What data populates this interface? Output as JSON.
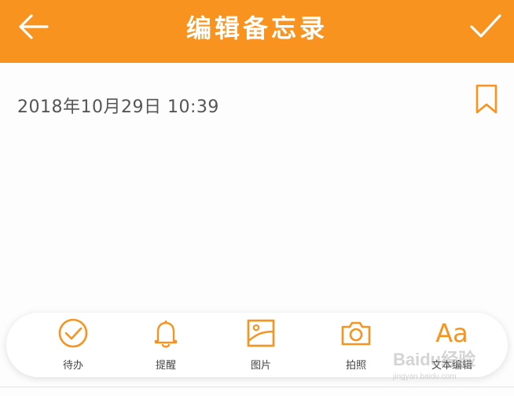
{
  "header": {
    "title": "编辑备忘录",
    "back_icon": "arrow-left-icon",
    "confirm_icon": "check-icon"
  },
  "note": {
    "datetime": "2018年10月29日  10:39",
    "bookmark_icon": "bookmark-icon"
  },
  "toolbar": {
    "items": [
      {
        "label": "待办",
        "icon": "check-circle-icon"
      },
      {
        "label": "提醒",
        "icon": "bell-icon"
      },
      {
        "label": "图片",
        "icon": "image-icon"
      },
      {
        "label": "拍照",
        "icon": "camera-icon"
      },
      {
        "label": "文本编辑",
        "icon": "text-format-icon",
        "glyph": "Aa"
      }
    ]
  },
  "watermark": {
    "brand": "Baidu经验",
    "url": "jingyan.baidu.com"
  },
  "colors": {
    "accent": "#f7931e",
    "text": "#555555",
    "background": "#fdfdfd"
  }
}
